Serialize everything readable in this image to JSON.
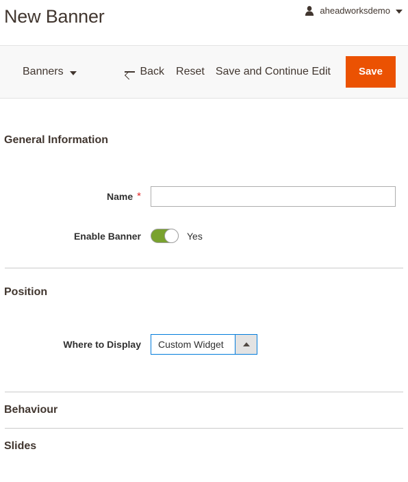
{
  "header": {
    "title": "New Banner",
    "user": {
      "icon": "user-icon",
      "name": "aheadworksdemo",
      "caret": "chevron-down-icon"
    }
  },
  "toolbar": {
    "store_switcher_label": "Banners",
    "store_switcher_caret": "chevron-down-icon",
    "back_icon": "arrow-left-icon",
    "back_label": "Back",
    "reset_label": "Reset",
    "save_continue_label": "Save and Continue Edit",
    "save_label": "Save",
    "save_button_color": "#eb5202"
  },
  "sections": {
    "general": {
      "title": "General Information",
      "fields": {
        "name": {
          "label": "Name",
          "required_mark": "*",
          "value": "",
          "placeholder": ""
        },
        "enable_banner": {
          "label": "Enable Banner",
          "state_label": "Yes",
          "checked": true,
          "on_color": "#79a22e"
        }
      }
    },
    "position": {
      "title": "Position",
      "fields": {
        "where_to_display": {
          "label": "Where to Display",
          "selected": "Custom Widget",
          "arrow_icon": "caret-up-icon",
          "focus_color": "#007bdb"
        }
      }
    },
    "behaviour": {
      "title": "Behaviour"
    },
    "slides": {
      "title": "Slides"
    }
  }
}
